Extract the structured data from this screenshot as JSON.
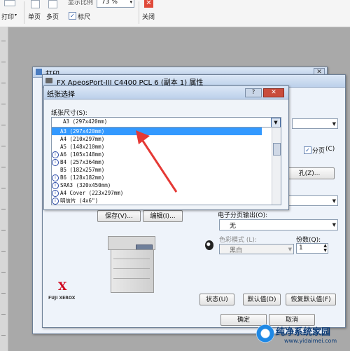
{
  "ribbon": {
    "print_label": "打印",
    "single_page_label": "单页",
    "multi_page_label": "多页",
    "display_ratio_label": "显示比例",
    "zoom_value": "73 %",
    "ruler_label": "标尺",
    "close_label": "关闭"
  },
  "outer_dialog": {
    "title": "打印"
  },
  "props_dialog": {
    "title": "FX ApeosPort-III C4400 PCL 6 (副本 1) 属性",
    "copies_section_label": "分页",
    "copies_section_mnemonic": "(C)",
    "hole_button": "孔(Z)...",
    "save_button": "保存(V)...",
    "edit_button": "编辑(I)...",
    "collate_output_label": "电子分页输出(O):",
    "collate_output_value": "无",
    "color_mode_label": "色彩模式 (L):",
    "color_mode_value": "黑白",
    "copies_label": "份数(Q):",
    "copies_value": "1",
    "brand_text": "FUJI XEROX",
    "status_button": "状态(U)",
    "default_button": "默认值(D)",
    "restore_default_button": "恢复默认值(F)",
    "ok_button": "确定",
    "cancel_button": "取消"
  },
  "paper_dialog": {
    "title": "纸张选择",
    "help_label": "?",
    "paper_size_label": "纸张尺寸(S):",
    "selected_value": "A3 (297x420mm)",
    "items": [
      {
        "label": "A3 (297x420mm)",
        "info": false
      },
      {
        "label": "A4 (210x297mm)",
        "info": false
      },
      {
        "label": "A5 (148x210mm)",
        "info": false
      },
      {
        "label": "A6 (105x148mm)",
        "info": true
      },
      {
        "label": "B4 (257x364mm)",
        "info": true
      },
      {
        "label": "B5 (182x257mm)",
        "info": false
      },
      {
        "label": "B6 (128x182mm)",
        "info": true
      },
      {
        "label": "SRA3 (320x450mm)",
        "info": true
      },
      {
        "label": "A4 Cover (223x297mm)",
        "info": true
      },
      {
        "label": "明信片 (4x6\")",
        "info": true
      }
    ]
  },
  "watermark": {
    "site_name": "纯净系统家园",
    "site_url": "www.yidaimei.com"
  },
  "colors": {
    "selection": "#3399ff",
    "arrow": "#e53935",
    "xerox_red": "#d0021b",
    "watermark_blue": "#1e88e5"
  }
}
